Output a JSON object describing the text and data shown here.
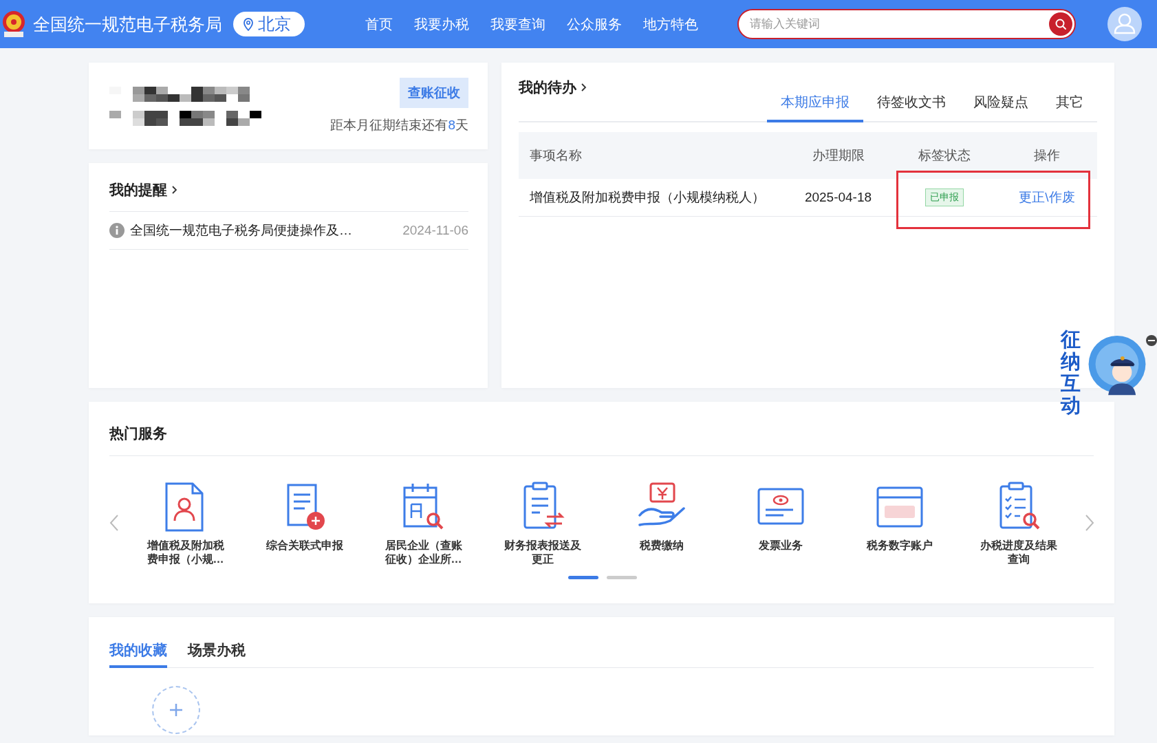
{
  "header": {
    "title": "全国统一规范电子税务局",
    "location": "北京",
    "nav": [
      {
        "label": "首页"
      },
      {
        "label": "我要办税"
      },
      {
        "label": "我要查询"
      },
      {
        "label": "公众服务"
      },
      {
        "label": "地方特色"
      }
    ],
    "search": {
      "placeholder": "请输入关键词"
    }
  },
  "account_card": {
    "button": "查账征收",
    "countdown_prefix": "距本月征期结束还有",
    "countdown_days": "8",
    "countdown_suffix": "天"
  },
  "reminders": {
    "title": "我的提醒",
    "items": [
      {
        "text": "全国统一规范电子税务局便捷操作及…",
        "date": "2024-11-06"
      }
    ]
  },
  "todo": {
    "title": "我的待办",
    "tabs": [
      {
        "label": "本期应申报",
        "selected": true
      },
      {
        "label": "待签收文书",
        "selected": false
      },
      {
        "label": "风险疑点",
        "selected": false
      },
      {
        "label": "其它",
        "selected": false
      }
    ],
    "columns": [
      "事项名称",
      "办理期限",
      "标签状态",
      "操作"
    ],
    "rows": [
      {
        "name": "增值税及附加税费申报（小规模纳税人）",
        "deadline": "2025-04-18",
        "status": "已申报",
        "action": "更正\\作废",
        "highlighted": true
      }
    ]
  },
  "hot_services": {
    "title": "热门服务",
    "items": [
      {
        "label": "增值税及附加税费申报（小规…"
      },
      {
        "label": "综合关联式申报"
      },
      {
        "label": "居民企业（查账征收）企业所…"
      },
      {
        "label": "财务报表报送及更正"
      },
      {
        "label": "税费缴纳"
      },
      {
        "label": "发票业务"
      },
      {
        "label": "税务数字账户"
      },
      {
        "label": "办税进度及结果查询"
      }
    ],
    "pages": [
      {
        "selected": true
      },
      {
        "selected": false
      }
    ]
  },
  "favorites": {
    "tabs": [
      {
        "label": "我的收藏",
        "selected": true
      },
      {
        "label": "场景办税",
        "selected": false
      }
    ]
  },
  "assistant": {
    "label": "征纳互动"
  }
}
